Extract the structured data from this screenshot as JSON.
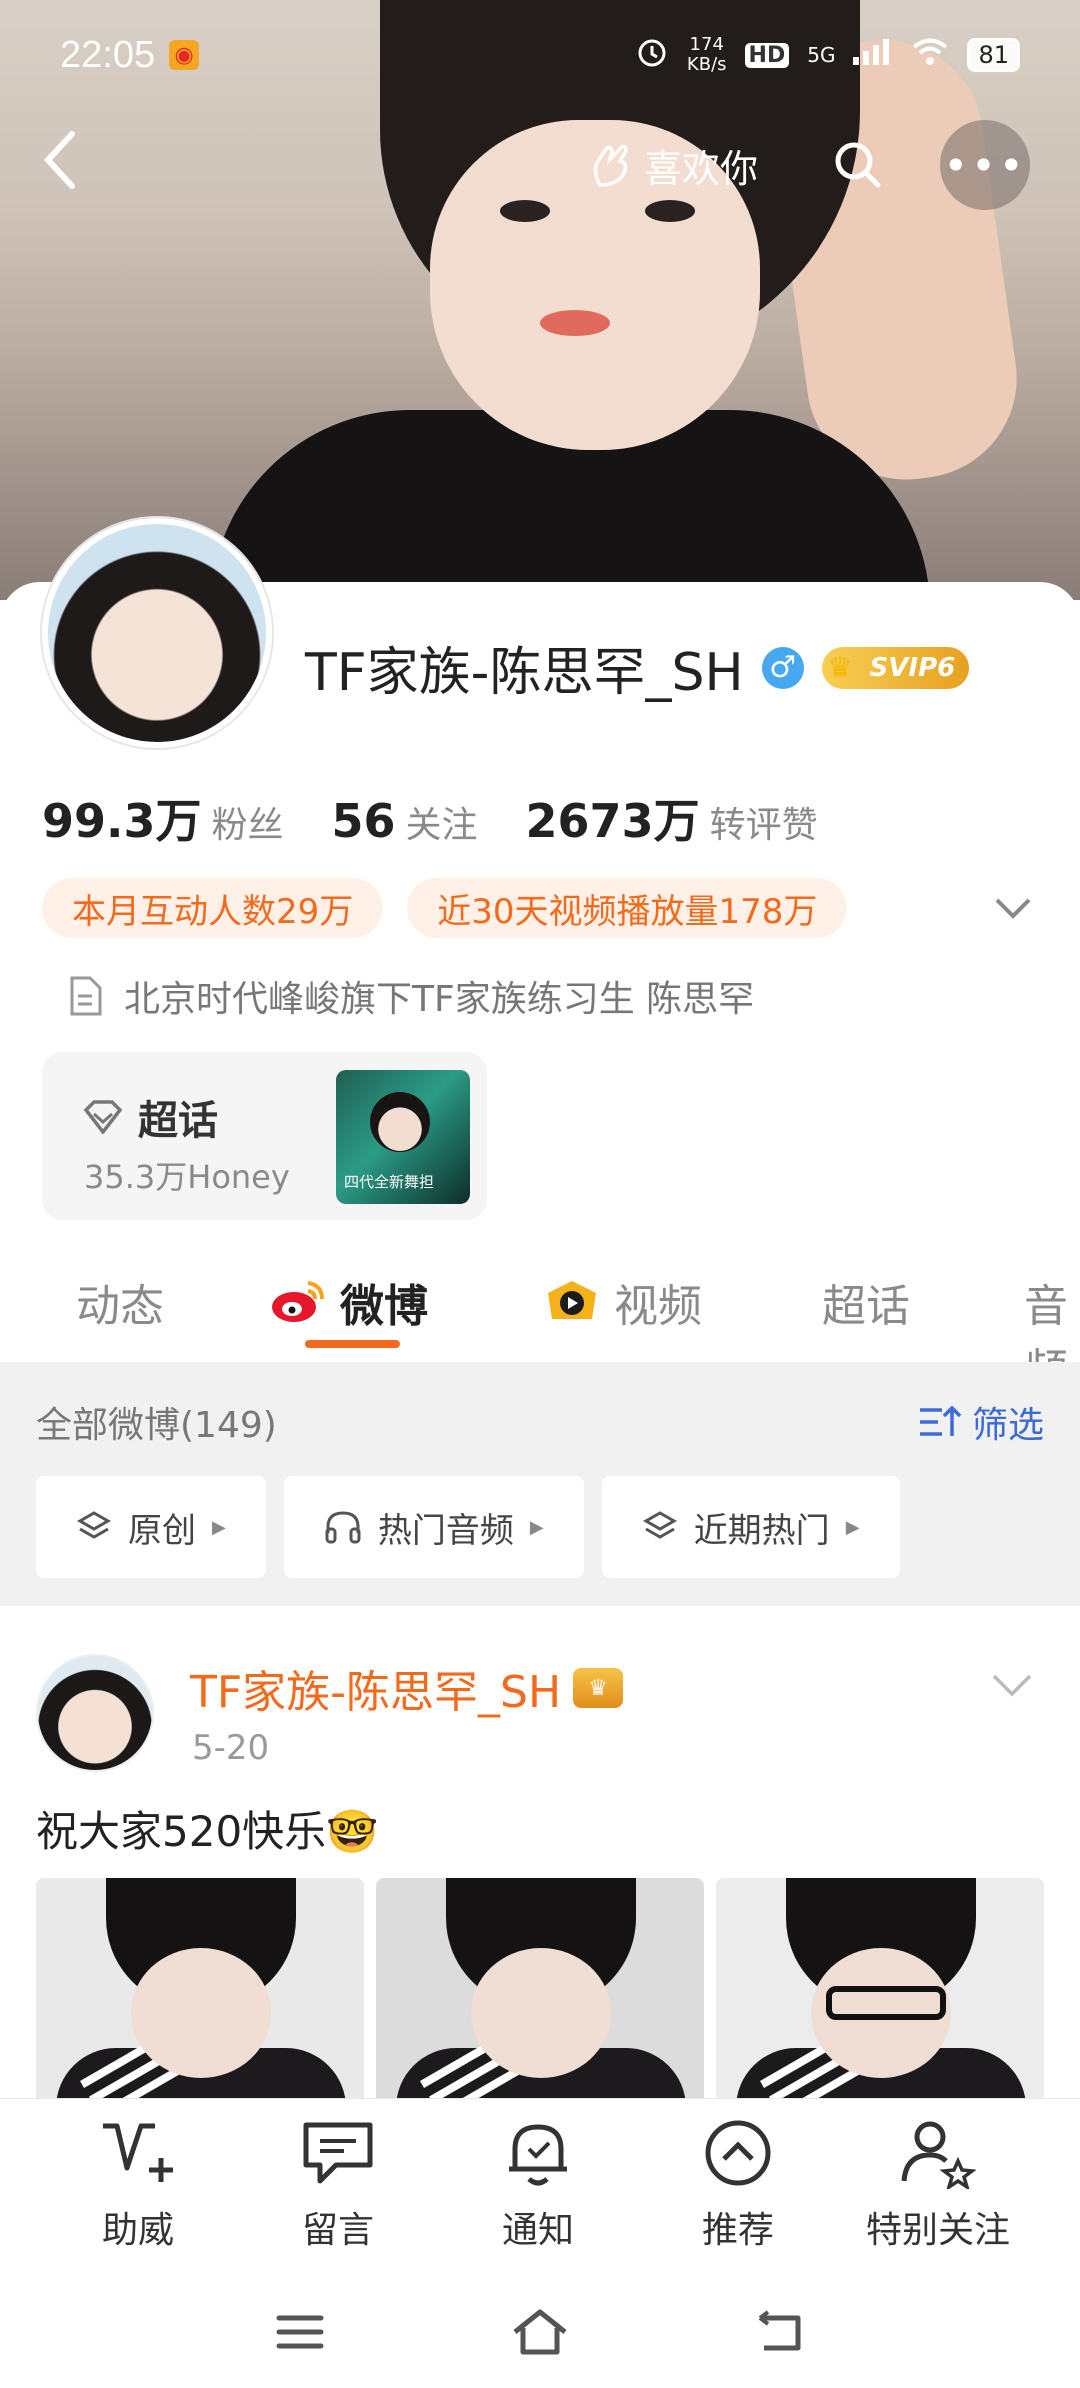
{
  "status_bar": {
    "time": "22:05",
    "net_speed": "174\nKB/s",
    "hd": "HD",
    "signal": "5G",
    "battery": "81"
  },
  "topbar": {
    "like_label": "喜欢你"
  },
  "profile": {
    "name": "TF家族-陈思罕_SH",
    "gender_symbol": "♂",
    "svip": "SVIP6",
    "stats": [
      {
        "value": "99.3万",
        "label": "粉丝"
      },
      {
        "value": "56",
        "label": "关注"
      },
      {
        "value": "2673万",
        "label": "转评赞"
      }
    ],
    "pills": [
      "本月互动人数29万",
      "近30天视频播放量178万"
    ],
    "description": "北京时代峰峻旗下TF家族练习生 陈思罕",
    "supertopic": {
      "title": "超话",
      "count": "35.3万Honey",
      "thumb_text": "四代全新舞担"
    }
  },
  "tabs": [
    "动态",
    "微博",
    "视频",
    "超话",
    "音频"
  ],
  "filter": {
    "label": "全部微博(149)",
    "screen": "筛选",
    "chips": [
      "原创",
      "热门音频",
      "近期热门"
    ]
  },
  "post": {
    "author": "TF家族-陈思罕_SH",
    "date": "5-20",
    "text": "祝大家520快乐🤓"
  },
  "actions": [
    "助威",
    "留言",
    "通知",
    "推荐",
    "特别关注"
  ],
  "colors": {
    "accent": "#f26a1b",
    "link_blue": "#3d6bd6",
    "pill_bg": "#fff1e8"
  }
}
